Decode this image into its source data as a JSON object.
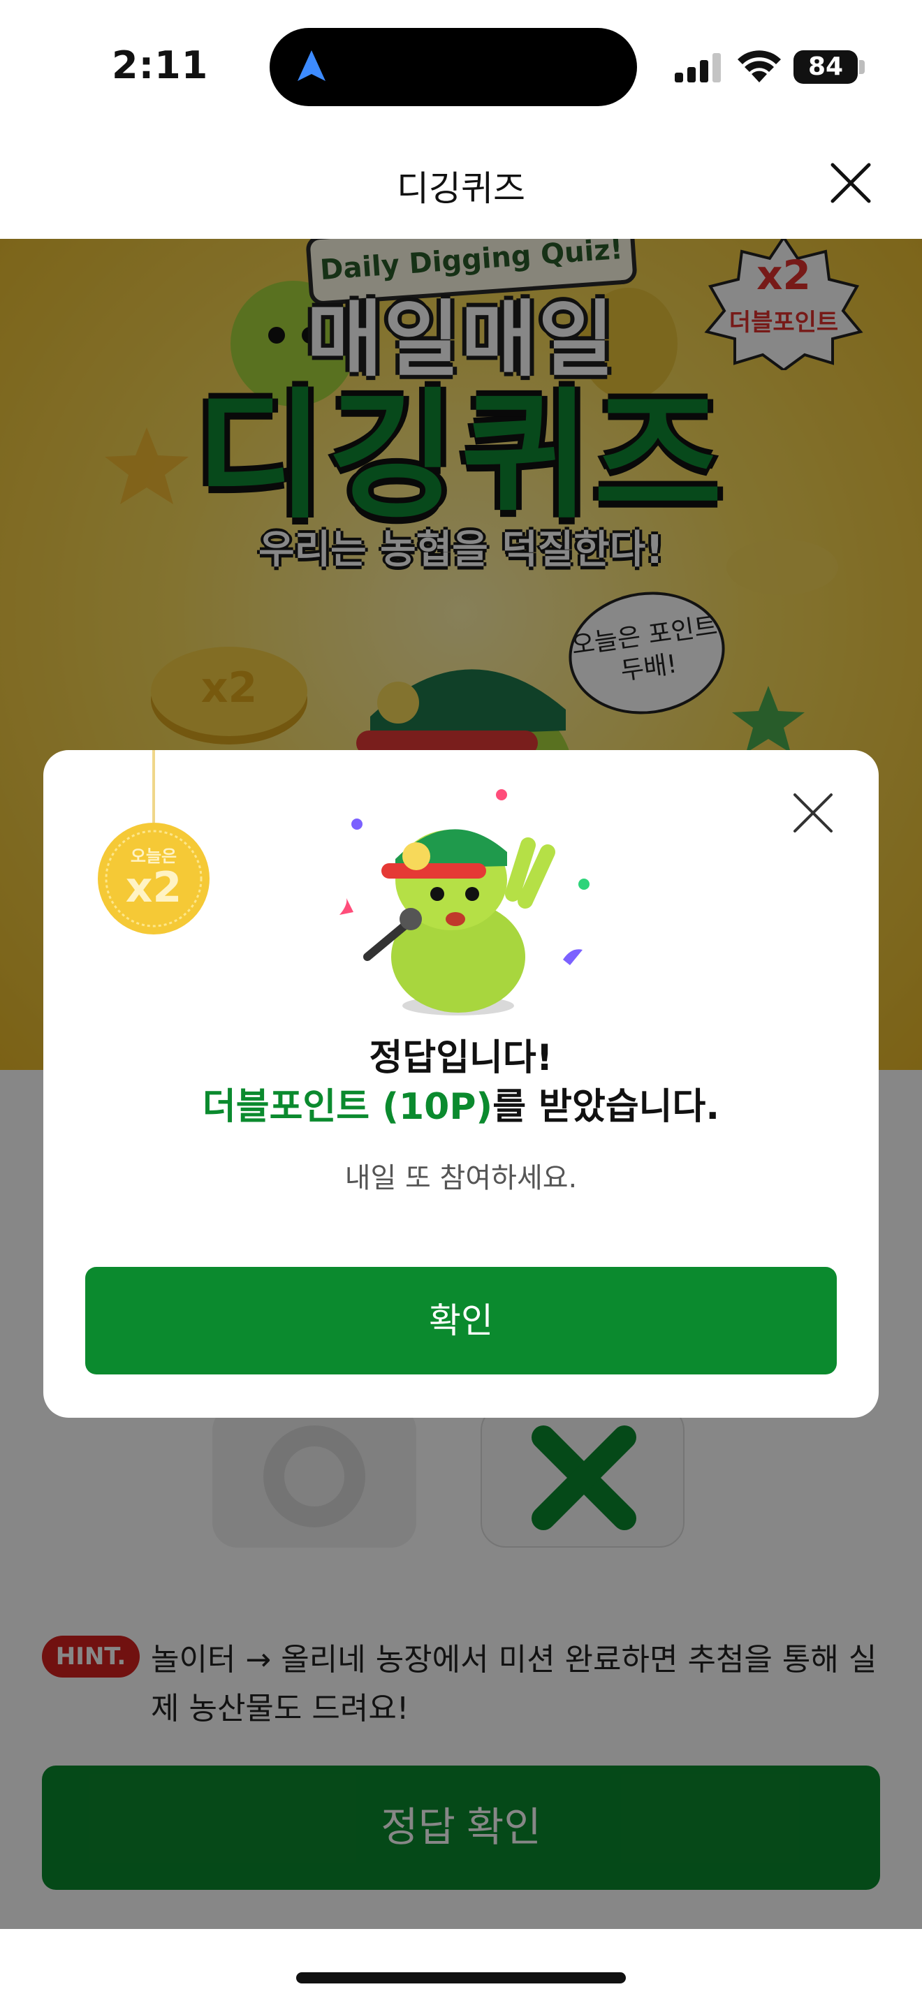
{
  "status_bar": {
    "time": "2:11",
    "battery": "84"
  },
  "header": {
    "title": "디깅퀴즈"
  },
  "banner": {
    "tag": "Daily Digging Quiz!",
    "title_line1": "매일매일",
    "title_line2": "디깅퀴즈",
    "subtitle": "우리는 농협을 덕질한다!",
    "double_badge_top": "x2",
    "double_badge_label": "더블포인트",
    "bubble_text": "오늘은 포인트 두배!",
    "coin_text": "x2"
  },
  "quiz": {
    "hint_badge": "HINT.",
    "hint_text": "놀이터 → 올리네 농장에서 미션 완료하면 추첨을 통해 실제 농산물도 드려요!",
    "answer_button": "정답 확인"
  },
  "modal": {
    "medal_top": "오늘은",
    "medal_text": "x2",
    "title": "정답입니다!",
    "highlight": "더블포인트 (10P)",
    "message_suffix": "를 받았습니다.",
    "description": "내일 또 참여하세요.",
    "confirm_button": "확인"
  },
  "colors": {
    "primary_green": "#0b8a2e",
    "hint_red": "#d5201f",
    "banner_yellow": "#f7d95a"
  }
}
